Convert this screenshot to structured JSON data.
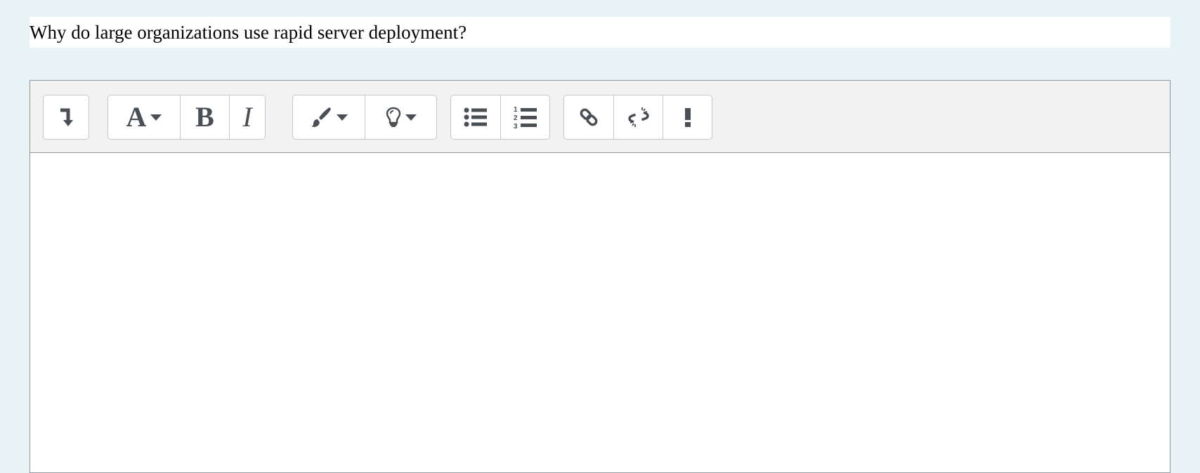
{
  "question": {
    "text": "Why do large organizations use rapid server deployment?"
  },
  "toolbar": {
    "show_more": {
      "icon": "level-down-arrow-icon",
      "glyph": "↴"
    },
    "font_style": {
      "icon": "font-style-icon",
      "label": "A"
    },
    "bold": {
      "icon": "bold-icon",
      "label": "B"
    },
    "italic": {
      "icon": "italic-icon",
      "label": "I"
    },
    "text_color": {
      "icon": "paint-brush-icon"
    },
    "highlight": {
      "icon": "lightbulb-icon"
    },
    "unordered_list": {
      "icon": "unordered-list-icon"
    },
    "ordered_list": {
      "icon": "ordered-list-icon",
      "numbers": [
        "1",
        "2",
        "3"
      ]
    },
    "link": {
      "icon": "link-icon"
    },
    "unlink": {
      "icon": "unlink-icon"
    },
    "important": {
      "icon": "exclamation-icon",
      "label": "!"
    }
  },
  "editor": {
    "content": ""
  },
  "colors": {
    "background": "#e7f3f5",
    "toolbar_bg": "#f2f2f2",
    "icon": "#4a4f55",
    "border": "#8f959e"
  }
}
